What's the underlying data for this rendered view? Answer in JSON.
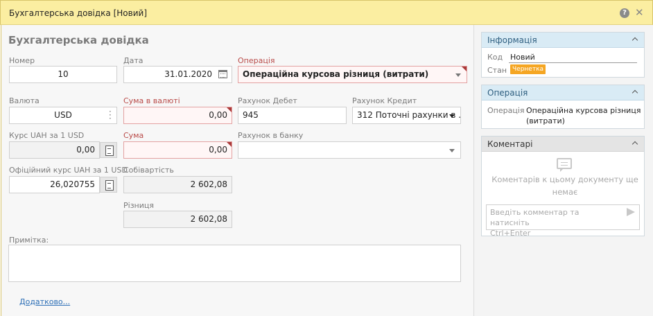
{
  "window": {
    "title": "Бухгалтерська довідка [Новий]",
    "help_label": "?",
    "close_label": "✕"
  },
  "form": {
    "title": "Бухгалтерська довідка",
    "number": {
      "label": "Номер",
      "value": "10"
    },
    "date": {
      "label": "Дата",
      "value": "31.01.2020"
    },
    "operation": {
      "label": "Операція",
      "value": "Операційна курсова різниця (витрати)"
    },
    "currency": {
      "label": "Валюта",
      "value": "USD"
    },
    "amount_currency": {
      "label": "Сума в валюті",
      "value": "0,00"
    },
    "debit": {
      "label": "Рахунок Дебет",
      "value": "945"
    },
    "credit": {
      "label": "Рахунок Кредит",
      "value": "312 Поточні рахунки в ..."
    },
    "rate": {
      "label": "Курс UAH за 1 USD",
      "value": "0,00"
    },
    "amount": {
      "label": "Сума",
      "value": "0,00"
    },
    "bank_account": {
      "label": "Рахунок в банку",
      "value": ""
    },
    "official_rate": {
      "label": "Офіційний курс UAH за 1 USD",
      "value": "26,020755"
    },
    "cost": {
      "label": "Собівартість",
      "value": "2 602,08"
    },
    "difference": {
      "label": "Різниця",
      "value": "2 602,08"
    },
    "note": {
      "label": "Примітка:",
      "value": ""
    },
    "more_link": "Додатково..."
  },
  "info_panel": {
    "title": "Інформація",
    "code_key": "Код",
    "code_value": "Новий",
    "state_key": "Стан",
    "state_value": "Чернетка"
  },
  "operation_panel": {
    "title": "Операція",
    "key": "Операція",
    "value_line1": "Операційна курсова різниця",
    "value_line2": "(витрати)"
  },
  "comments_panel": {
    "title": "Коментарі",
    "empty_line1": "Коментарів к цьому документу ще",
    "empty_line2": "немає",
    "placeholder_line1": "Введіть комментар та натисніть",
    "placeholder_line2": "Ctrl+Enter"
  },
  "colors": {
    "title_bar": "#fbeea1",
    "panel_header": "#d9ebf5",
    "badge": "#f5a623",
    "required_label": "#b94a48",
    "link": "#2a6db5"
  }
}
